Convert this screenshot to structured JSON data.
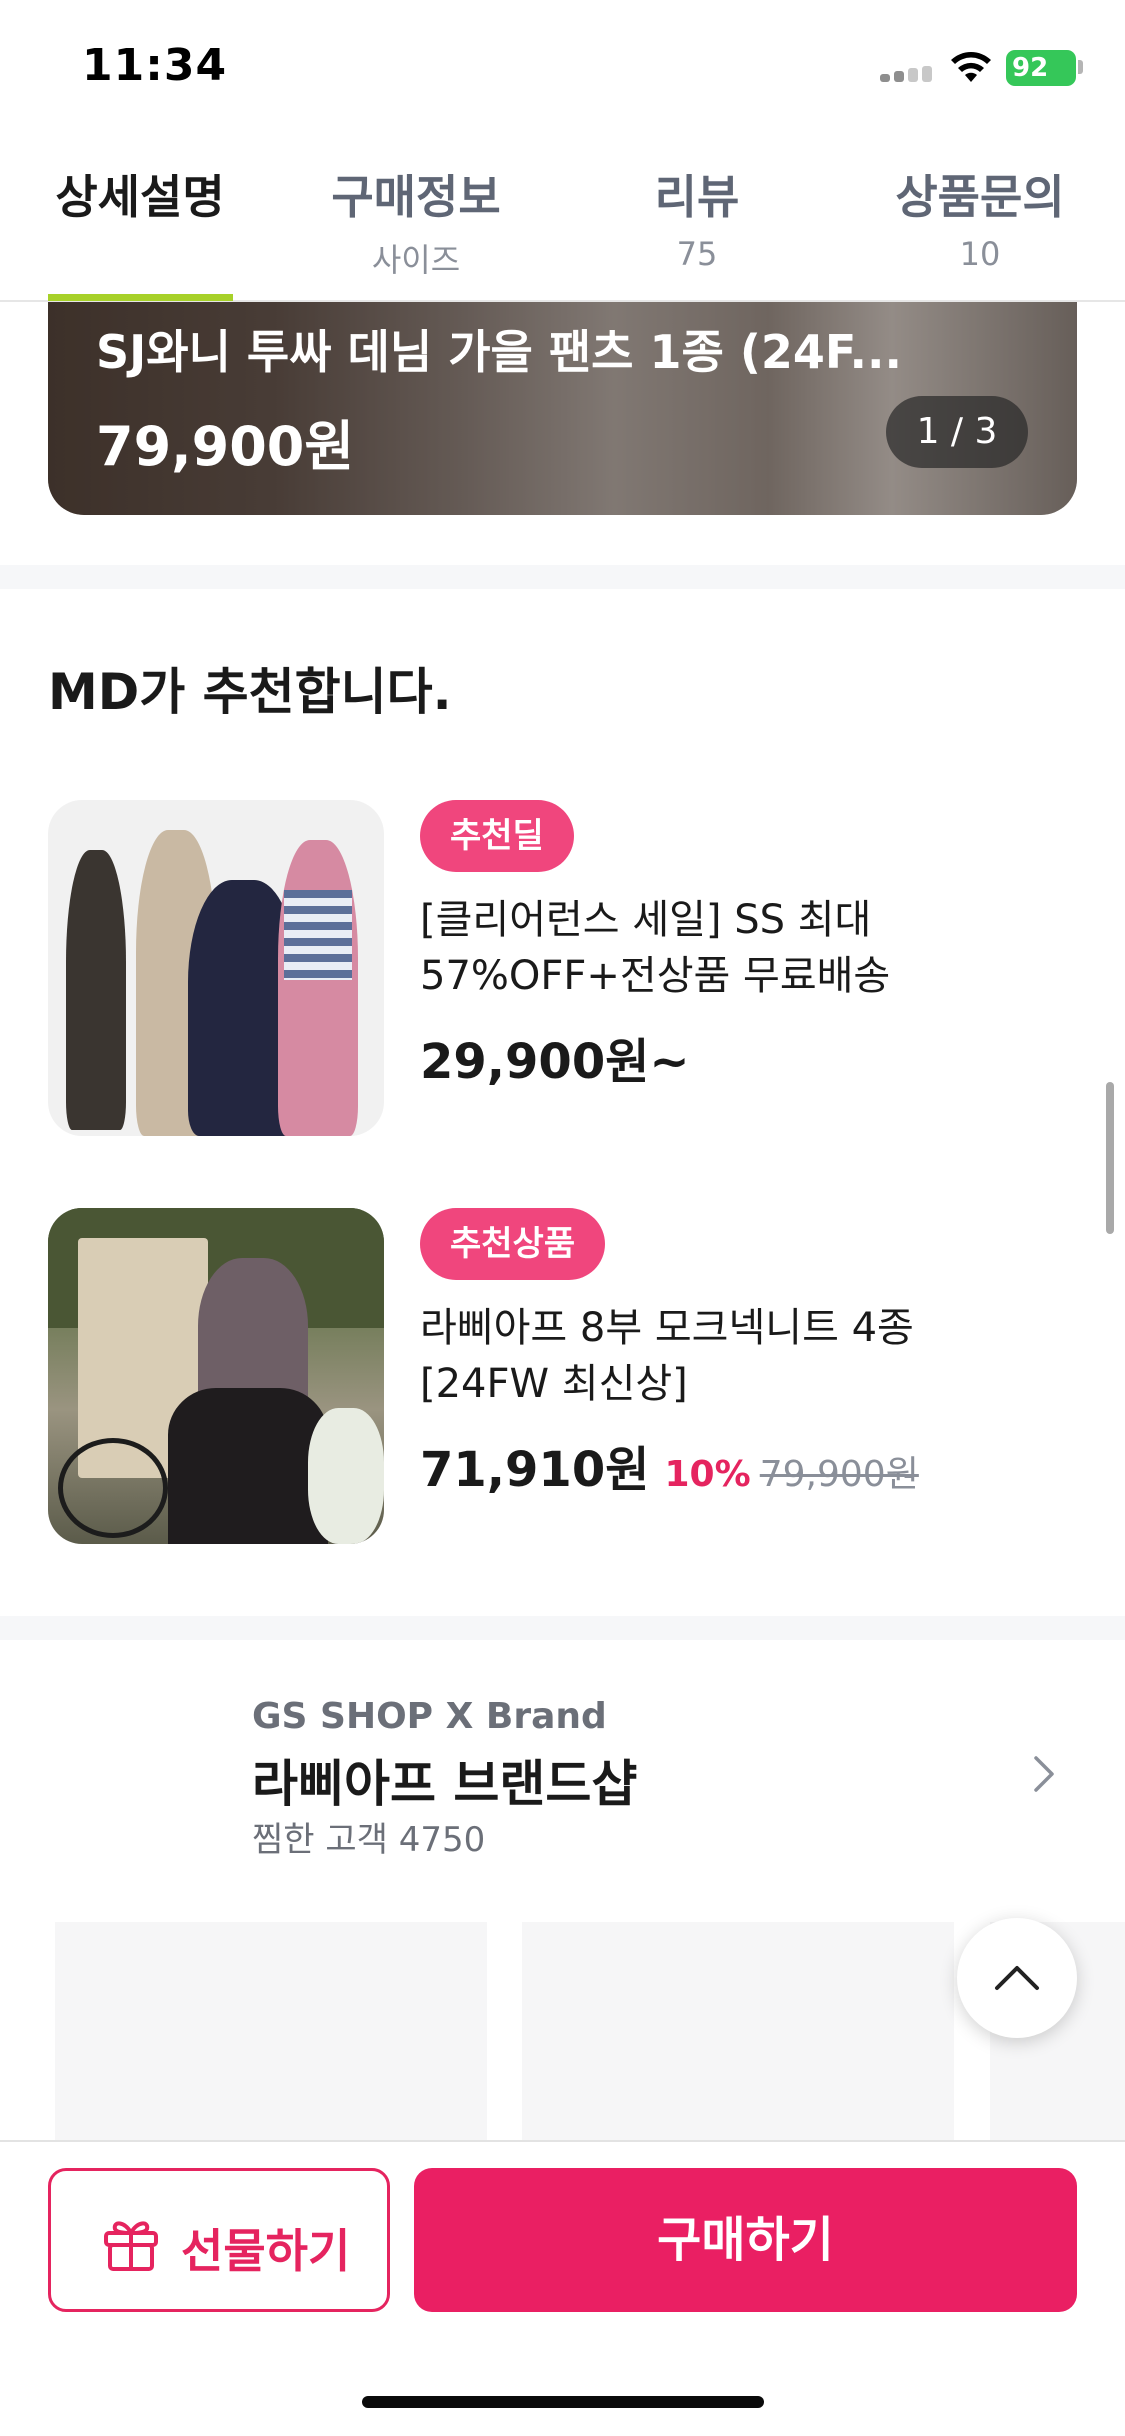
{
  "status_bar": {
    "time": "11:34",
    "battery": "92"
  },
  "tabs": [
    {
      "label": "상세설명",
      "sub": ""
    },
    {
      "label": "구매정보",
      "sub": "사이즈"
    },
    {
      "label": "리뷰",
      "sub": "75"
    },
    {
      "label": "상품문의",
      "sub": "10"
    }
  ],
  "hero": {
    "title": "SJ와니 투싸 데님 가을 팬츠 1종 (24F...",
    "price": "79,900원",
    "pager": "1 / 3"
  },
  "md_section": {
    "title": "MD가 추천합니다.",
    "items": [
      {
        "badge": "추천딜",
        "name_line1": "[클리어런스 세일] SS 최대",
        "name_line2": "57%OFF+전상품 무료배송",
        "price": "29,900원~",
        "discount": "",
        "original_price": ""
      },
      {
        "badge": "추천상품",
        "name_line1": "라삐아프 8부 모크넥니트 4종",
        "name_line2": "[24FW 최신상]",
        "price": "71,910원",
        "discount": "10%",
        "original_price": "79,900원"
      }
    ]
  },
  "brand": {
    "eyebrow": "GS SHOP X Brand",
    "name": "라삐아프 브랜드샵",
    "likes": "찜한 고객 4750"
  },
  "bottom_bar": {
    "gift_label": "선물하기",
    "buy_label": "구매하기"
  },
  "colors": {
    "accent": "#ea1f63",
    "badge": "#f0467d",
    "tab_indicator": "#a7d129",
    "battery": "#35c759"
  }
}
